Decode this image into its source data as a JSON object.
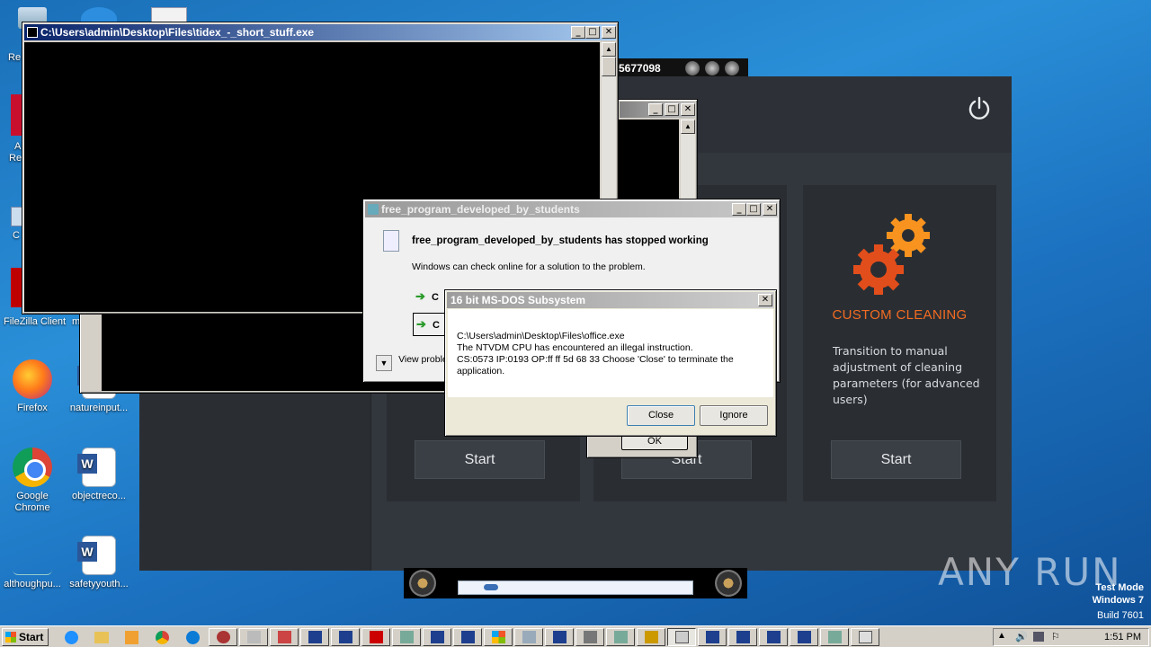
{
  "desktop": {
    "icons": [
      {
        "label": "FileZilla Client"
      },
      {
        "label": "Firefox"
      },
      {
        "label": "natureinput..."
      },
      {
        "label": "Google Chrome"
      },
      {
        "label": "objectreco..."
      },
      {
        "label": "althoughpu..."
      },
      {
        "label": "safetyyouth..."
      }
    ],
    "partial_labels": [
      "Re",
      "A",
      "Re",
      "C",
      "m"
    ]
  },
  "cleaner": {
    "cards": [
      {
        "button": "Start"
      },
      {
        "button": "Start"
      },
      {
        "title": "CUSTOM CLEANING",
        "description": "Transition to manual adjustment of cleaning parameters (for advanced users)",
        "button": "Start"
      }
    ],
    "accent_color": "#f36b21"
  },
  "media_player": {
    "counter_fragment": "5677098"
  },
  "console_window": {
    "title": "C:\\Users\\admin\\Desktop\\Files\\tidex_-_short_stuff.exe"
  },
  "error_dialog": {
    "title": "free_program_developed_by_students",
    "heading": "free_program_developed_by_students has stopped working",
    "message": "Windows can check online for a solution to the problem.",
    "option1_fragment": "C",
    "option2_fragment": "C",
    "view_problem": "View proble"
  },
  "ntvdm_dialog": {
    "title": "16 bit MS-DOS Subsystem",
    "lines": [
      "C:\\Users\\admin\\Desktop\\Files\\office.exe",
      "The NTVDM CPU has encountered an illegal instruction.",
      "CS:0573 IP:0193 OP:ff ff 5d 68 33 Choose 'Close' to terminate the",
      "application."
    ],
    "close_button": "Close",
    "ignore_button": "Ignore"
  },
  "hidden_ok_button": "OK",
  "watermark": {
    "brand": "ANY RUN",
    "line1": "Test Mode",
    "line2": "Windows 7",
    "line3": "Build 7601"
  },
  "taskbar": {
    "start_label": "Start",
    "clock": "1:51 PM"
  }
}
